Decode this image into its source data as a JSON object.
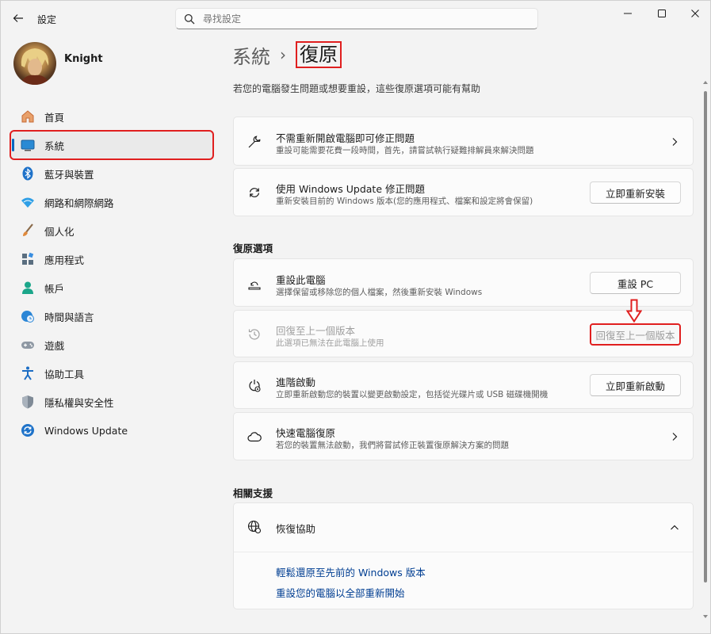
{
  "window": {
    "title": "設定"
  },
  "search": {
    "placeholder": "尋找設定"
  },
  "profile": {
    "name": "Knight"
  },
  "sidebar": {
    "items": [
      {
        "label": "首頁",
        "icon": "home-icon"
      },
      {
        "label": "系統",
        "icon": "system-display-icon",
        "selected": true
      },
      {
        "label": "藍牙與裝置",
        "icon": "bluetooth-icon"
      },
      {
        "label": "網路和網際網路",
        "icon": "wifi-icon"
      },
      {
        "label": "個人化",
        "icon": "paintbrush-icon"
      },
      {
        "label": "應用程式",
        "icon": "apps-icon"
      },
      {
        "label": "帳戶",
        "icon": "person-icon"
      },
      {
        "label": "時間與語言",
        "icon": "clock-globe-icon"
      },
      {
        "label": "遊戲",
        "icon": "gamepad-icon"
      },
      {
        "label": "協助工具",
        "icon": "accessibility-icon"
      },
      {
        "label": "隱私權與安全性",
        "icon": "shield-icon"
      },
      {
        "label": "Windows Update",
        "icon": "update-icon"
      }
    ]
  },
  "breadcrumb": {
    "parent": "系統",
    "separator": "›",
    "current": "復原"
  },
  "page": {
    "description": "若您的電腦發生問題或想要重設，這些復原選項可能有幫助"
  },
  "cards": {
    "troubleshoot": {
      "title": "不需重新開啟電腦即可修正問題",
      "subtitle": "重設可能需要花費一段時間，首先，請嘗試執行疑難排解員來解決問題"
    },
    "windows_update_fix": {
      "title": "使用 Windows Update 修正問題",
      "subtitle": "重新安裝目前的 Windows 版本(您的應用程式、檔案和設定將會保留)",
      "button": "立即重新安裝"
    }
  },
  "recovery_options": {
    "section_title": "復原選項",
    "reset_pc": {
      "title": "重設此電腦",
      "subtitle": "選擇保留或移除您的個人檔案，然後重新安裝 Windows",
      "button": "重設 PC"
    },
    "go_back": {
      "title": "回復至上一個版本",
      "subtitle": "此選項已無法在此電腦上使用",
      "button": "回復至上一個版本",
      "enabled": false
    },
    "advanced_startup": {
      "title": "進階啟動",
      "subtitle": "立即重新啟動您的裝置以變更啟動設定，包括從光碟片或 USB 磁碟機開機",
      "button": "立即重新啟動"
    },
    "quick_recovery": {
      "title": "快速電腦復原",
      "subtitle": "若您的裝置無法啟動，我們將嘗試修正裝置復原解決方案的問題"
    }
  },
  "related_support": {
    "section_title": "相關支援",
    "recovery_help": {
      "title": "恢復協助",
      "expanded": true
    },
    "links": [
      "輕鬆還原至先前的 Windows 版本",
      "重設您的電腦以全部重新開始"
    ]
  },
  "colors": {
    "accent": "#0067c0",
    "highlight_box": "#e01f1f",
    "link": "#003e92"
  }
}
